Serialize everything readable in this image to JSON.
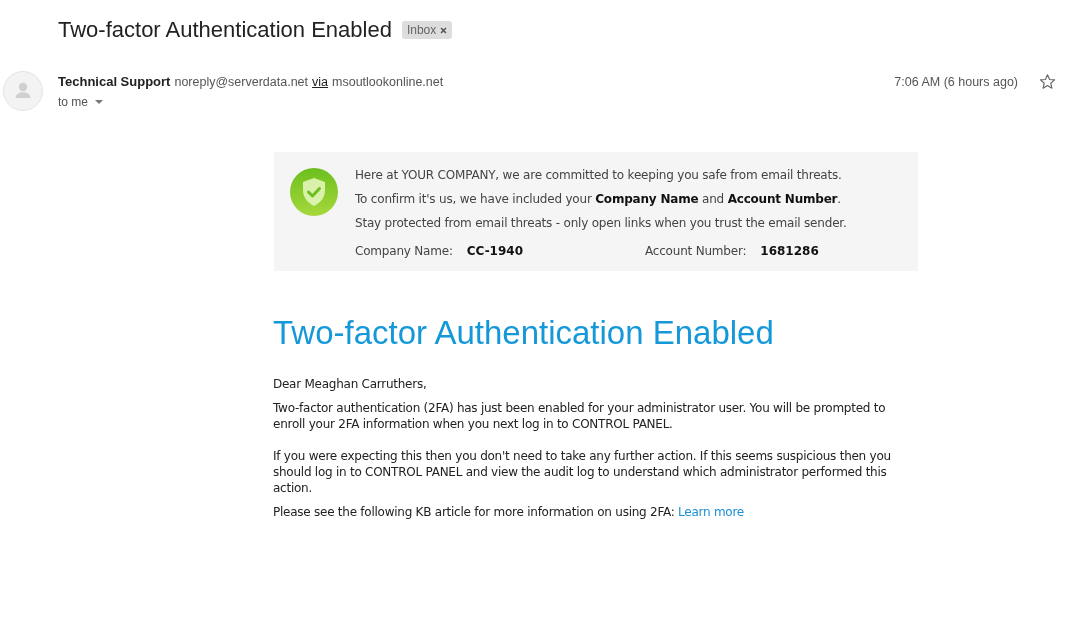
{
  "message": {
    "subject": "Two-factor Authentication Enabled",
    "labels": [
      {
        "text": "Inbox"
      }
    ],
    "sender": {
      "name": "Technical Support",
      "email": "noreply@serverdata.net",
      "via_label": "via",
      "via_domain": "msoutlookonline.net"
    },
    "recipient": "to me",
    "time": "7:06 AM (6 hours ago)",
    "starred": false
  },
  "notice": {
    "lines": [
      "Here at YOUR COMPANY, we are committed to keeping you safe from email threats.",
      "To confirm it's us, we have included your **Company Name** and **Account Number**.",
      "Stay protected from email threats - only open links when you trust the email sender."
    ],
    "fields": [
      {
        "label": "Company Name:",
        "value": "CC-1940"
      },
      {
        "label": "Account Number:",
        "value": "1681286"
      }
    ]
  },
  "body": {
    "heading": "Two-factor Authentication Enabled",
    "paragraphs": [
      {
        "text": "Dear Meaghan Carruthers,"
      },
      {
        "text": "Two-factor authentication (2FA) has just been enabled for your administrator user. You will be prompted to enroll your 2FA information when you next log in to CONTROL PANEL."
      },
      {
        "text": "If you were expecting this then you don't need to take any further action. If this seems suspicious then you should log in to CONTROL PANEL and view the audit log to understand which administrator performed this action."
      },
      {
        "text": "Please see the following KB article for more information on using 2FA:",
        "link": "Learn more"
      }
    ]
  }
}
